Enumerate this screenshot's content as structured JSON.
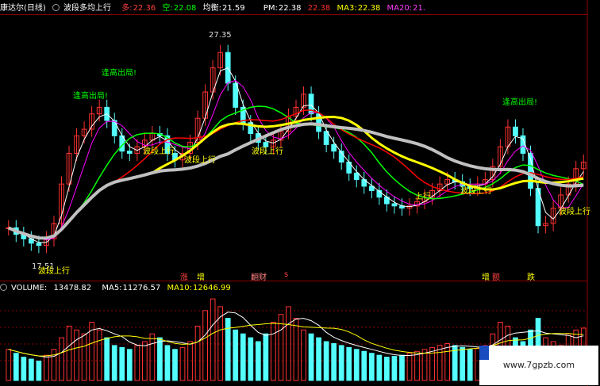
{
  "header": {
    "stock_name": "康达尔(日线)",
    "indicator": "波段多均上行",
    "bull_label": "多:",
    "bull_value": "22.36",
    "bear_label": "空:",
    "bear_value": "22.08",
    "avg_label": "均衡:",
    "avg_value": "21.59",
    "pm_label": "PM:",
    "pm_value": "22.38",
    "pm_value2": "22.38",
    "ma3_label": "MA3:",
    "ma3_value": "22.38",
    "ma20_label": "MA20:",
    "ma20_value": "21."
  },
  "volume_header": {
    "volume_label": "VOLUME:",
    "volume_value": "13478.82",
    "ma5_label": "MA5:",
    "ma5_value": "11276.57",
    "ma10_label": "MA10:",
    "ma10_value": "12646.99"
  },
  "price_marks": {
    "high": "27.35",
    "low": "17.51"
  },
  "annotations": {
    "peak1": "逢高出局!",
    "peak2": "逢高出局!",
    "peak3": "逢高出局!",
    "up1": "波段上行",
    "up2": "波段上行",
    "up3": "波段上行",
    "up4": "波段上行",
    "up5": "波段上行",
    "up6": "上行",
    "up7": "波段上行"
  },
  "events": {
    "e1": "涨",
    "e2": "增",
    "e3": "翻财",
    "e4": "s",
    "e5": "增",
    "e6": "额",
    "e7": "跌"
  },
  "watermark": "www.7gpzb.com",
  "colors": {
    "up_candle": "#ff3232",
    "down_candle": "#54ffff",
    "grid": "#8b0000",
    "ma_white": "#ffffff",
    "ma_yellow": "#ffff00",
    "ma_green": "#00ff00",
    "ma_magenta": "#ff00ff",
    "ma_gray": "#c0c0c0",
    "ma_red": "#ff0000",
    "ma_blue": "#2040ff"
  },
  "chart_data": {
    "type": "candlestick",
    "price_range": [
      16.5,
      28.0
    ],
    "closes": [
      18.4,
      18.1,
      17.9,
      17.7,
      17.6,
      17.9,
      18.6,
      20.4,
      21.8,
      22.6,
      22.9,
      23.6,
      23.9,
      23.3,
      22.6,
      21.9,
      21.8,
      22.1,
      22.4,
      22.7,
      22.6,
      21.8,
      21.5,
      21.8,
      22.3,
      23.4,
      24.6,
      25.7,
      26.4,
      25.0,
      23.9,
      23.2,
      22.7,
      22.3,
      22.1,
      22.4,
      22.8,
      23.5,
      23.9,
      24.5,
      23.6,
      22.8,
      22.2,
      21.9,
      21.4,
      20.9,
      20.6,
      20.3,
      20.1,
      19.8,
      19.5,
      19.4,
      19.3,
      19.4,
      19.6,
      19.8,
      20.1,
      20.4,
      20.6,
      20.5,
      20.3,
      20.2,
      20.4,
      20.6,
      21.2,
      22.1,
      23.0,
      22.6,
      21.8,
      20.2,
      18.5,
      18.6,
      19.3,
      19.9,
      20.4,
      21.1,
      21.4
    ],
    "volumes": [
      8000,
      7000,
      6000,
      5500,
      5000,
      6500,
      8000,
      11000,
      14000,
      13000,
      12000,
      15000,
      13000,
      11000,
      9000,
      8500,
      8000,
      9000,
      10000,
      12000,
      11000,
      9000,
      8000,
      8500,
      10000,
      14000,
      18000,
      21000,
      19000,
      16000,
      13000,
      12000,
      11000,
      10000,
      12000,
      15000,
      17000,
      19000,
      16000,
      13000,
      12000,
      11000,
      10000,
      9500,
      9000,
      8500,
      8000,
      7500,
      7000,
      6500,
      6000,
      6200,
      6500,
      7000,
      7500,
      8000,
      8500,
      9000,
      9500,
      9000,
      8500,
      8000,
      8200,
      9000,
      12000,
      15000,
      14000,
      11000,
      10000,
      13000,
      16000,
      11000,
      10000,
      9000,
      12000,
      13000,
      13478
    ]
  }
}
